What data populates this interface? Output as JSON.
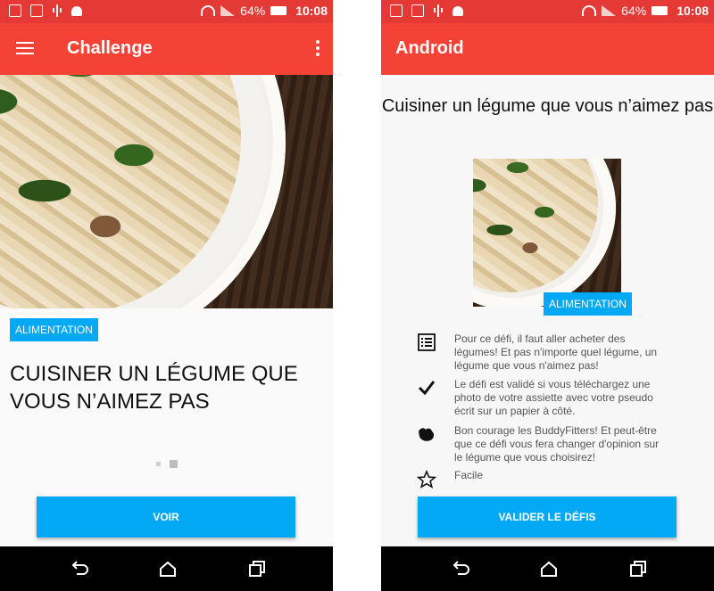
{
  "left": {
    "status_bar": {
      "battery": "64%",
      "time": "10:08"
    },
    "app_bar": {
      "title": "Challenge"
    },
    "badge": "ALIMENTATION",
    "challenge_title": "CUISINER UN LÉGUME QUE VOUS N’AIMEZ PAS",
    "button": "VOIR"
  },
  "right": {
    "status_bar": {
      "battery": "64%",
      "time": "10:08"
    },
    "app_bar": {
      "title": "Android"
    },
    "challenge_title": "Cuisiner un légume que vous n’aimez pas",
    "badge": "ALIMENTATION",
    "details": [
      {
        "icon": "list-icon",
        "text": "Pour ce défi, il faut aller acheter des légumes! Et pas n'importe quel légume, un légume que vous n'aimez pas!"
      },
      {
        "icon": "check-icon",
        "text": "Le défi est validé si vous téléchargez une photo de votre assiette avec votre pseudo écrit sur un papier à côté."
      },
      {
        "icon": "muscle-icon",
        "text": "Bon courage les BuddyFitters! Et peut-être que ce défi vous fera changer d'opinion sur le légume que vous choisirez!"
      },
      {
        "icon": "star-icon",
        "text": "Facile"
      }
    ],
    "button": "VALIDER LE DÉFIS"
  },
  "colors": {
    "status_bar": "#e53935",
    "app_bar": "#f44336",
    "accent": "#03a9f4",
    "nav_bar": "#000000"
  }
}
